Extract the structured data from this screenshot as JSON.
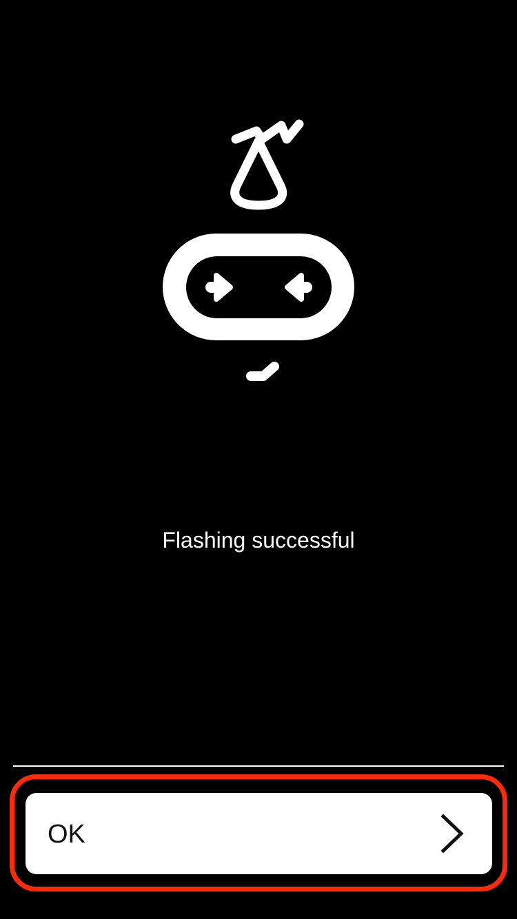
{
  "status": {
    "message": "Flashing successful"
  },
  "mascot": {
    "icon": "microbit-face-icon",
    "color": "#ffffff"
  },
  "actions": {
    "ok_label": "OK",
    "ok_icon": "chevron-right-icon",
    "highlight_color": "#ff2a0a"
  }
}
